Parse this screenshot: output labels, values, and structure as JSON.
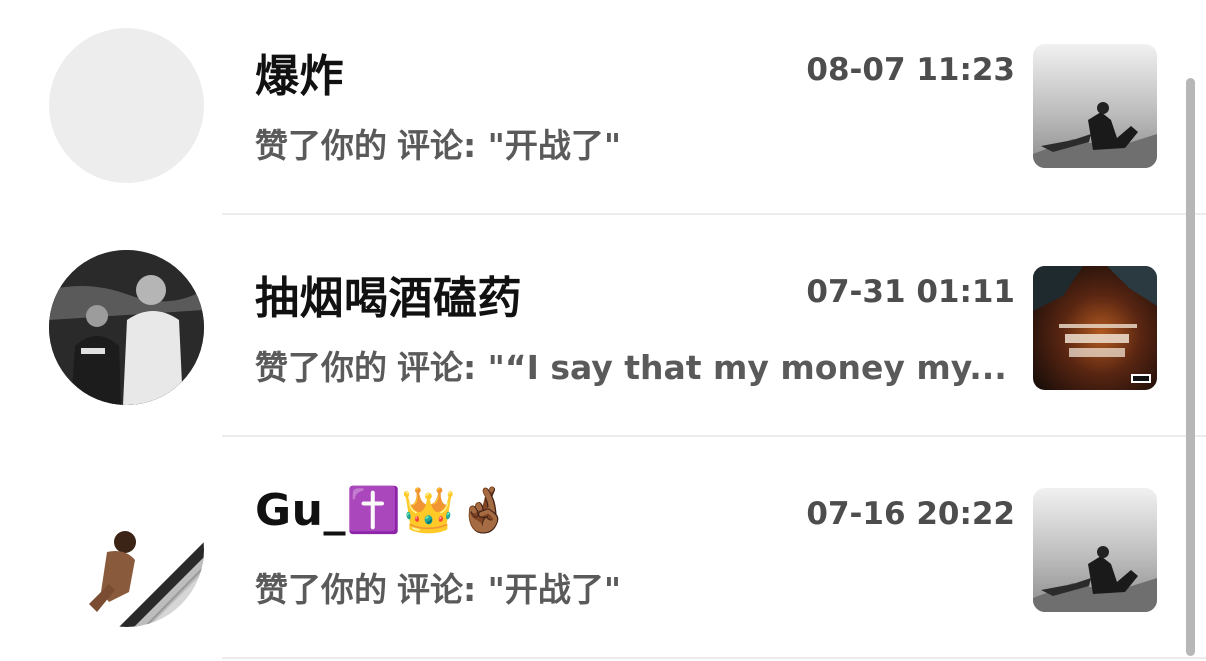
{
  "notifications": [
    {
      "username": "爆炸",
      "time": "08-07 11:23",
      "action_prefix": "赞了你的",
      "action_text": "评论: \"开战了\"",
      "avatar": "empty-avatar",
      "thumbnail": "grayscale-stage-photo"
    },
    {
      "username": "抽烟喝酒磕药",
      "time": "07-31 01:11",
      "action_prefix": "赞了你的",
      "action_text": "评论: \"“I say that my money my...",
      "avatar": "two-people-photo",
      "thumbnail": "album-cover-ain't-over"
    },
    {
      "username": "Gu_✝️👑🤞🏾",
      "time": "07-16 20:22",
      "action_prefix": "赞了你的",
      "action_text": "评论: \"开战了\"",
      "avatar": "person-on-escalator",
      "thumbnail": "grayscale-stage-photo"
    }
  ],
  "colors": {
    "name": "#111111",
    "time": "#4d4d4d",
    "action": "#5a5a5a",
    "divider": "#ececec",
    "scrollbar": "#b7b7b7"
  }
}
